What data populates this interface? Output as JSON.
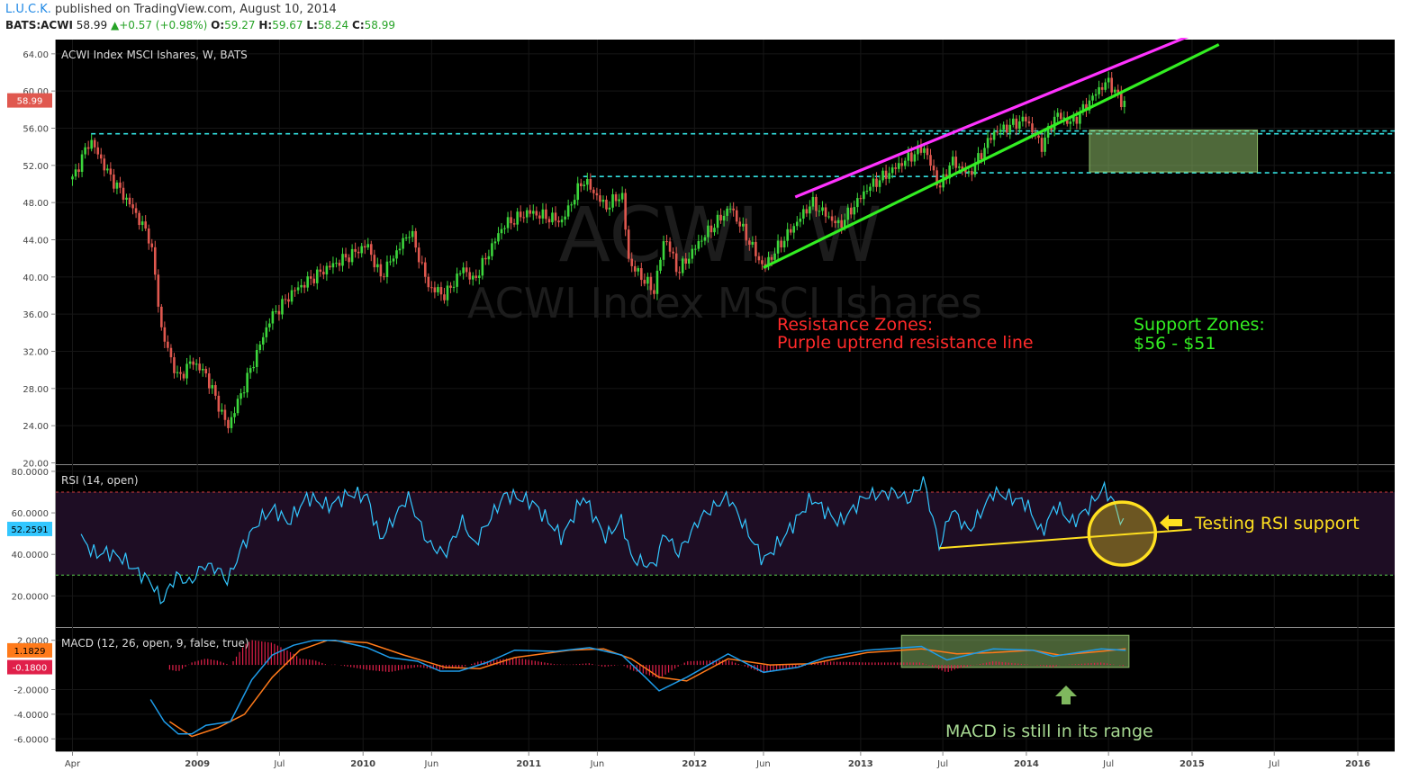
{
  "header": {
    "author": "L.U.C.K.",
    "published_text": "published on TradingView.com, August 10, 2014",
    "symbol": "BATS:ACWI",
    "last": "58.99",
    "change": "+0.57 (+0.98%)",
    "open_label": "O:",
    "open": "59.27",
    "high_label": "H:",
    "high": "59.67",
    "low_label": "L:",
    "low": "58.24",
    "close_label": "C:",
    "close": "58.99"
  },
  "colors": {
    "background": "#000000",
    "up_candle": "#3cd63c",
    "down_candle": "#e0584f",
    "resistance_line": "#ff33ff",
    "support_line": "#33ee22",
    "level_line": "#33e0e0",
    "rsi_line": "#33c7ff",
    "macd_line": "#1e9be8",
    "signal_line": "#ff7a1a",
    "histogram": "#e0204a",
    "zone_fill": "#8fbf6a",
    "annotation_red": "#ff2a2a",
    "annotation_green": "#33ee22",
    "annotation_yellow": "#ffe020",
    "annotation_lightgreen": "#a7d992"
  },
  "chart_data": [
    {
      "type": "candlestick",
      "title": "ACWI Index MSCI Ishares, W, BATS",
      "watermark_symbol": "ACWI, W",
      "watermark_name": "ACWI Index MSCI Ishares",
      "ylim": [
        20,
        65
      ],
      "yticks": [
        "64.00",
        "60.00",
        "56.00",
        "52.00",
        "48.00",
        "44.00",
        "40.00",
        "36.00",
        "32.00",
        "28.00",
        "24.00",
        "20.00"
      ],
      "last_price_label": "58.99",
      "x_tick_labels": [
        "Apr",
        "2009",
        "Jul",
        "2010",
        "Jun",
        "2011",
        "Jun",
        "2012",
        "Jun",
        "2013",
        "Jul",
        "2014",
        "Jul",
        "2015",
        "Jul",
        "2016"
      ],
      "price_path": [
        [
          "2008-04-01",
          50.5
        ],
        [
          "2008-05-10",
          54.8
        ],
        [
          "2008-06-20",
          51.0
        ],
        [
          "2008-08-10",
          47.5
        ],
        [
          "2008-09-20",
          44.0
        ],
        [
          "2008-10-15",
          34.0
        ],
        [
          "2008-11-20",
          29.0
        ],
        [
          "2008-12-20",
          31.0
        ],
        [
          "2009-01-20",
          29.5
        ],
        [
          "2009-03-09",
          23.8
        ],
        [
          "2009-04-20",
          29.0
        ],
        [
          "2009-06-10",
          35.5
        ],
        [
          "2009-08-01",
          38.5
        ],
        [
          "2009-10-15",
          41.0
        ],
        [
          "2009-12-10",
          42.5
        ],
        [
          "2010-01-10",
          43.5
        ],
        [
          "2010-02-08",
          40.0
        ],
        [
          "2010-04-15",
          45.0
        ],
        [
          "2010-05-25",
          39.0
        ],
        [
          "2010-07-01",
          38.0
        ],
        [
          "2010-08-10",
          41.0
        ],
        [
          "2010-09-01",
          39.5
        ],
        [
          "2010-11-05",
          45.5
        ],
        [
          "2010-12-31",
          47.0
        ],
        [
          "2011-03-15",
          46.0
        ],
        [
          "2011-05-01",
          50.5
        ],
        [
          "2011-06-20",
          47.5
        ],
        [
          "2011-07-25",
          49.0
        ],
        [
          "2011-08-10",
          41.5
        ],
        [
          "2011-10-04",
          38.5
        ],
        [
          "2011-10-28",
          44.5
        ],
        [
          "2011-11-25",
          40.5
        ],
        [
          "2012-01-15",
          44.0
        ],
        [
          "2012-03-20",
          47.5
        ],
        [
          "2012-06-01",
          41.0
        ],
        [
          "2012-07-15",
          44.0
        ],
        [
          "2012-09-15",
          48.0
        ],
        [
          "2012-11-15",
          45.5
        ],
        [
          "2013-01-15",
          49.5
        ],
        [
          "2013-05-20",
          54.0
        ],
        [
          "2013-06-24",
          49.5
        ],
        [
          "2013-07-20",
          52.5
        ],
        [
          "2013-08-28",
          51.0
        ],
        [
          "2013-10-20",
          55.5
        ],
        [
          "2013-12-31",
          57.0
        ],
        [
          "2014-02-03",
          54.0
        ],
        [
          "2014-03-07",
          57.5
        ],
        [
          "2014-04-11",
          56.5
        ],
        [
          "2014-06-15",
          60.5
        ],
        [
          "2014-07-03",
          61.0
        ],
        [
          "2014-07-31",
          58.6
        ],
        [
          "2014-08-08",
          58.99
        ]
      ],
      "trendlines": [
        {
          "name": "Purple uptrend resistance line",
          "from": [
            "2012-08-10",
            48.6
          ],
          "to": [
            "2014-12-30",
            66.0
          ]
        },
        {
          "name": "Green uptrend support line",
          "from": [
            "2012-06-01",
            41.0
          ],
          "to": [
            "2015-03-01",
            65.0
          ]
        }
      ],
      "horizontal_levels": [
        {
          "from": "2008-05-12",
          "value": 55.4
        },
        {
          "from": "2011-05-01",
          "value": 50.8,
          "to": "2013-08-01"
        },
        {
          "from": "2013-04-25",
          "value": 55.7
        },
        {
          "from": "2013-08-01",
          "value": 51.2
        }
      ],
      "support_zone": {
        "from": "2014-05-20",
        "to": "2015-05-25",
        "low": 51.3,
        "high": 55.8
      },
      "annotations": [
        {
          "text": "Resistance Zones:"
        },
        {
          "text": "Purple uptrend resistance line"
        },
        {
          "text": "Support Zones:"
        },
        {
          "text": "$56 - $51"
        }
      ]
    },
    {
      "type": "line",
      "title": "RSI (14, open)",
      "ylim": [
        5,
        83
      ],
      "yticks": [
        "80.0000",
        "60.0000",
        "40.0000",
        "20.0000"
      ],
      "last_value_label": "52.2591",
      "band": [
        30,
        70
      ],
      "rsi_path": [
        [
          "2008-04-20",
          48
        ],
        [
          "2008-05-20",
          40
        ],
        [
          "2008-06-20",
          41
        ],
        [
          "2008-07-20",
          38
        ],
        [
          "2008-08-20",
          32
        ],
        [
          "2008-09-20",
          27
        ],
        [
          "2008-10-15",
          17
        ],
        [
          "2008-11-15",
          30
        ],
        [
          "2008-12-15",
          26
        ],
        [
          "2009-01-15",
          35
        ],
        [
          "2009-02-15",
          33
        ],
        [
          "2009-03-09",
          27
        ],
        [
          "2009-04-10",
          44
        ],
        [
          "2009-05-20",
          57
        ],
        [
          "2009-06-20",
          62
        ],
        [
          "2009-07-20",
          55
        ],
        [
          "2009-09-01",
          68
        ],
        [
          "2009-10-15",
          63
        ],
        [
          "2009-12-01",
          69
        ],
        [
          "2010-01-10",
          68
        ],
        [
          "2010-02-08",
          47
        ],
        [
          "2010-04-10",
          68
        ],
        [
          "2010-05-25",
          45
        ],
        [
          "2010-07-01",
          40
        ],
        [
          "2010-08-10",
          57
        ],
        [
          "2010-09-01",
          44
        ],
        [
          "2010-11-10",
          69
        ],
        [
          "2011-01-10",
          65
        ],
        [
          "2011-03-15",
          48
        ],
        [
          "2011-05-01",
          68
        ],
        [
          "2011-06-20",
          48
        ],
        [
          "2011-07-25",
          57
        ],
        [
          "2011-08-15",
          38
        ],
        [
          "2011-10-04",
          34
        ],
        [
          "2011-10-28",
          51
        ],
        [
          "2011-11-25",
          40
        ],
        [
          "2012-01-15",
          58
        ],
        [
          "2012-03-15",
          68
        ],
        [
          "2012-06-01",
          37
        ],
        [
          "2012-07-15",
          48
        ],
        [
          "2012-09-15",
          67
        ],
        [
          "2012-11-15",
          55
        ],
        [
          "2013-01-10",
          68
        ],
        [
          "2013-03-15",
          70
        ],
        [
          "2013-04-20",
          66
        ],
        [
          "2013-05-20",
          76
        ],
        [
          "2013-06-24",
          43
        ],
        [
          "2013-07-20",
          62
        ],
        [
          "2013-08-28",
          51
        ],
        [
          "2013-10-20",
          70
        ],
        [
          "2013-12-31",
          65
        ],
        [
          "2014-02-03",
          50
        ],
        [
          "2014-03-07",
          64
        ],
        [
          "2014-04-11",
          55
        ],
        [
          "2014-05-20",
          63
        ],
        [
          "2014-06-20",
          72
        ],
        [
          "2014-07-10",
          66
        ],
        [
          "2014-07-25",
          58
        ],
        [
          "2014-08-08",
          52
        ]
      ],
      "trendline": {
        "from": [
          "2013-06-24",
          43
        ],
        "to": [
          "2014-12-31",
          52
        ]
      },
      "highlight_center": [
        "2014-07-31",
        50
      ],
      "annotation": "Testing RSI support"
    },
    {
      "type": "line",
      "title": "MACD (12, 26, open, 9, false, true)",
      "ylim": [
        -7,
        3
      ],
      "yticks": [
        "2.0000",
        "-2.0000",
        "-4.0000",
        "-6.0000"
      ],
      "last_value_labels": [
        "1.1829",
        "-0.1800"
      ],
      "macd_path": [
        [
          "2008-09-20",
          -2.8
        ],
        [
          "2008-10-20",
          -4.6
        ],
        [
          "2008-11-20",
          -5.6
        ],
        [
          "2008-12-20",
          -5.6
        ],
        [
          "2009-01-20",
          -4.9
        ],
        [
          "2009-03-15",
          -4.6
        ],
        [
          "2009-05-01",
          -1.2
        ],
        [
          "2009-06-15",
          0.8
        ],
        [
          "2009-08-01",
          1.6
        ],
        [
          "2009-09-15",
          2.0
        ],
        [
          "2009-11-01",
          2.0
        ],
        [
          "2010-01-10",
          1.4
        ],
        [
          "2010-03-01",
          0.6
        ],
        [
          "2010-05-01",
          0.3
        ],
        [
          "2010-06-20",
          -0.5
        ],
        [
          "2010-08-01",
          -0.5
        ],
        [
          "2010-10-01",
          0.2
        ],
        [
          "2010-12-01",
          1.2
        ],
        [
          "2011-03-01",
          1.1
        ],
        [
          "2011-05-15",
          1.4
        ],
        [
          "2011-07-25",
          0.8
        ],
        [
          "2011-09-15",
          -1.0
        ],
        [
          "2011-10-15",
          -2.1
        ],
        [
          "2011-12-15",
          -1.0
        ],
        [
          "2012-03-15",
          0.9
        ],
        [
          "2012-06-01",
          -0.6
        ],
        [
          "2012-08-15",
          -0.2
        ],
        [
          "2012-10-15",
          0.6
        ],
        [
          "2013-01-15",
          1.2
        ],
        [
          "2013-05-15",
          1.5
        ],
        [
          "2013-07-10",
          0.4
        ],
        [
          "2013-10-20",
          1.3
        ],
        [
          "2014-01-15",
          1.2
        ],
        [
          "2014-03-01",
          0.7
        ],
        [
          "2014-06-15",
          1.3
        ],
        [
          "2014-08-08",
          1.18
        ]
      ],
      "signal_path": [
        [
          "2008-11-01",
          -4.6
        ],
        [
          "2008-12-20",
          -5.8
        ],
        [
          "2009-02-15",
          -5.1
        ],
        [
          "2009-04-15",
          -4.0
        ],
        [
          "2009-06-15",
          -1.0
        ],
        [
          "2009-08-15",
          1.2
        ],
        [
          "2009-10-15",
          2.0
        ],
        [
          "2010-01-10",
          1.8
        ],
        [
          "2010-04-01",
          0.8
        ],
        [
          "2010-07-01",
          -0.2
        ],
        [
          "2010-09-15",
          -0.3
        ],
        [
          "2010-12-01",
          0.6
        ],
        [
          "2011-04-01",
          1.2
        ],
        [
          "2011-06-15",
          1.3
        ],
        [
          "2011-08-15",
          0.5
        ],
        [
          "2011-10-15",
          -1.0
        ],
        [
          "2011-12-15",
          -1.3
        ],
        [
          "2012-03-15",
          0.5
        ],
        [
          "2012-06-15",
          0.0
        ],
        [
          "2012-09-15",
          0.1
        ],
        [
          "2013-01-15",
          1.0
        ],
        [
          "2013-05-15",
          1.3
        ],
        [
          "2013-08-01",
          0.9
        ],
        [
          "2013-10-20",
          1.0
        ],
        [
          "2014-01-15",
          1.2
        ],
        [
          "2014-03-15",
          0.8
        ],
        [
          "2014-06-15",
          1.1
        ],
        [
          "2014-08-08",
          1.3
        ]
      ],
      "range_box": {
        "from": "2013-04-01",
        "to": "2014-08-15",
        "low": -0.2,
        "high": 2.4
      },
      "annotation": "MACD is still in its range"
    }
  ]
}
